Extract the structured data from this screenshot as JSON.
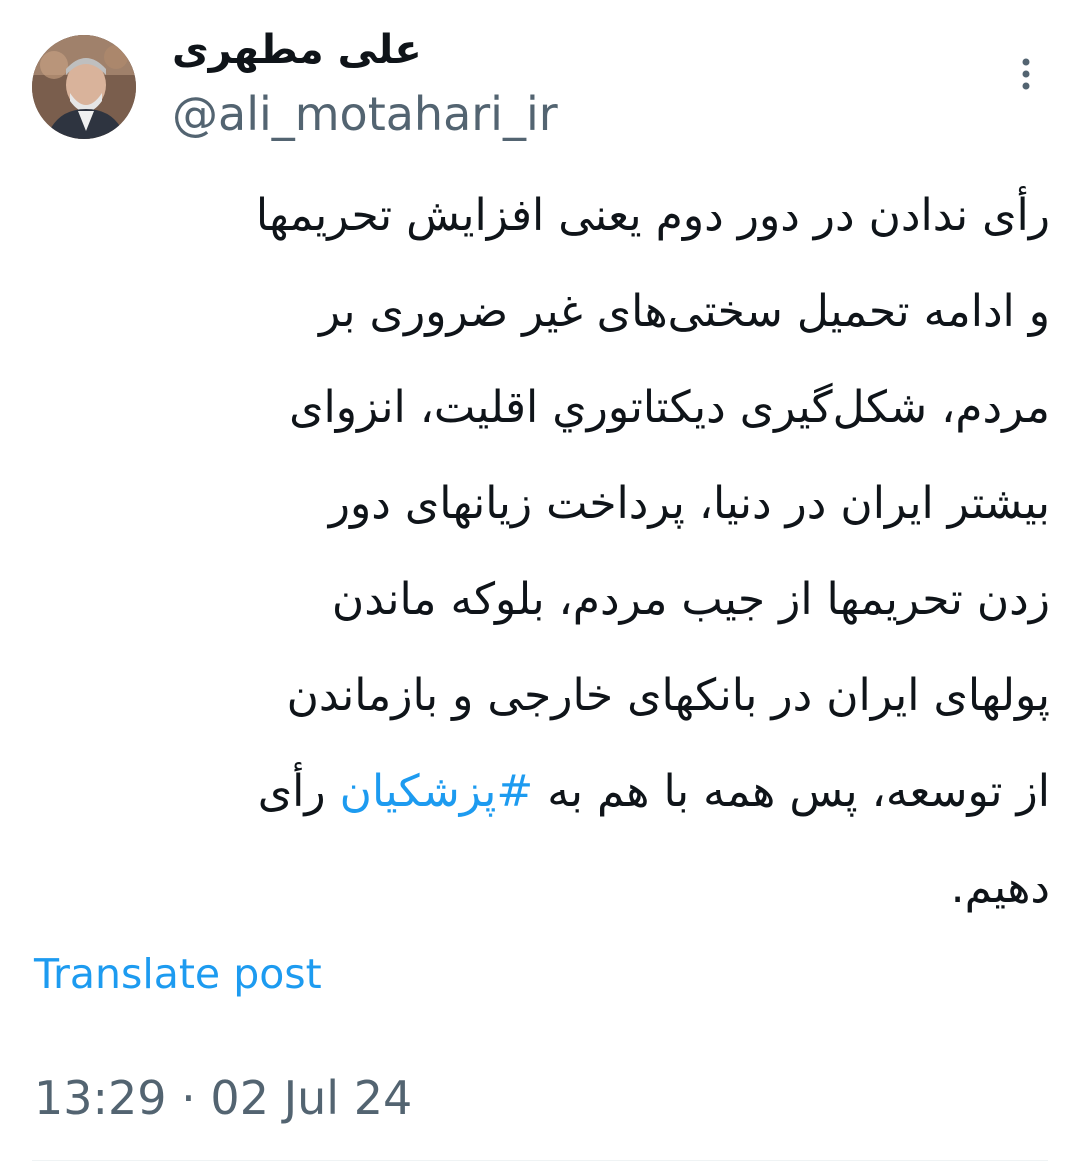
{
  "author": {
    "display_name": "علی مطهری",
    "handle": "@ali_motahari_ir"
  },
  "menu": {
    "icon": "more-vertical-icon"
  },
  "tweet": {
    "text_before": "رأی ندادن در دور دوم یعنی افزایش تحریمها\nو ادامه تحمیل سختی‌های غیر ضروری بر\nمردم، شکل‌گیری دیکتاتوري اقلیت، انزوای\nبیشتر ایران در دنیا، پرداخت زیانهای دور\nزدن تحریمها از جیب مردم، بلوکه ماندن\nپولهای ایران در بانکهای خارجی و بازماندن\nاز توسعه،  پس همه با هم به ",
    "hashtag": "#پزشکیان",
    "text_after": " رأی\nدهیم."
  },
  "translate_label": "Translate post",
  "timestamp": "13:29 · 02 Jul 24",
  "colors": {
    "link": "#1d9bf0",
    "secondary_text": "#536471",
    "primary_text": "#0f1419"
  }
}
